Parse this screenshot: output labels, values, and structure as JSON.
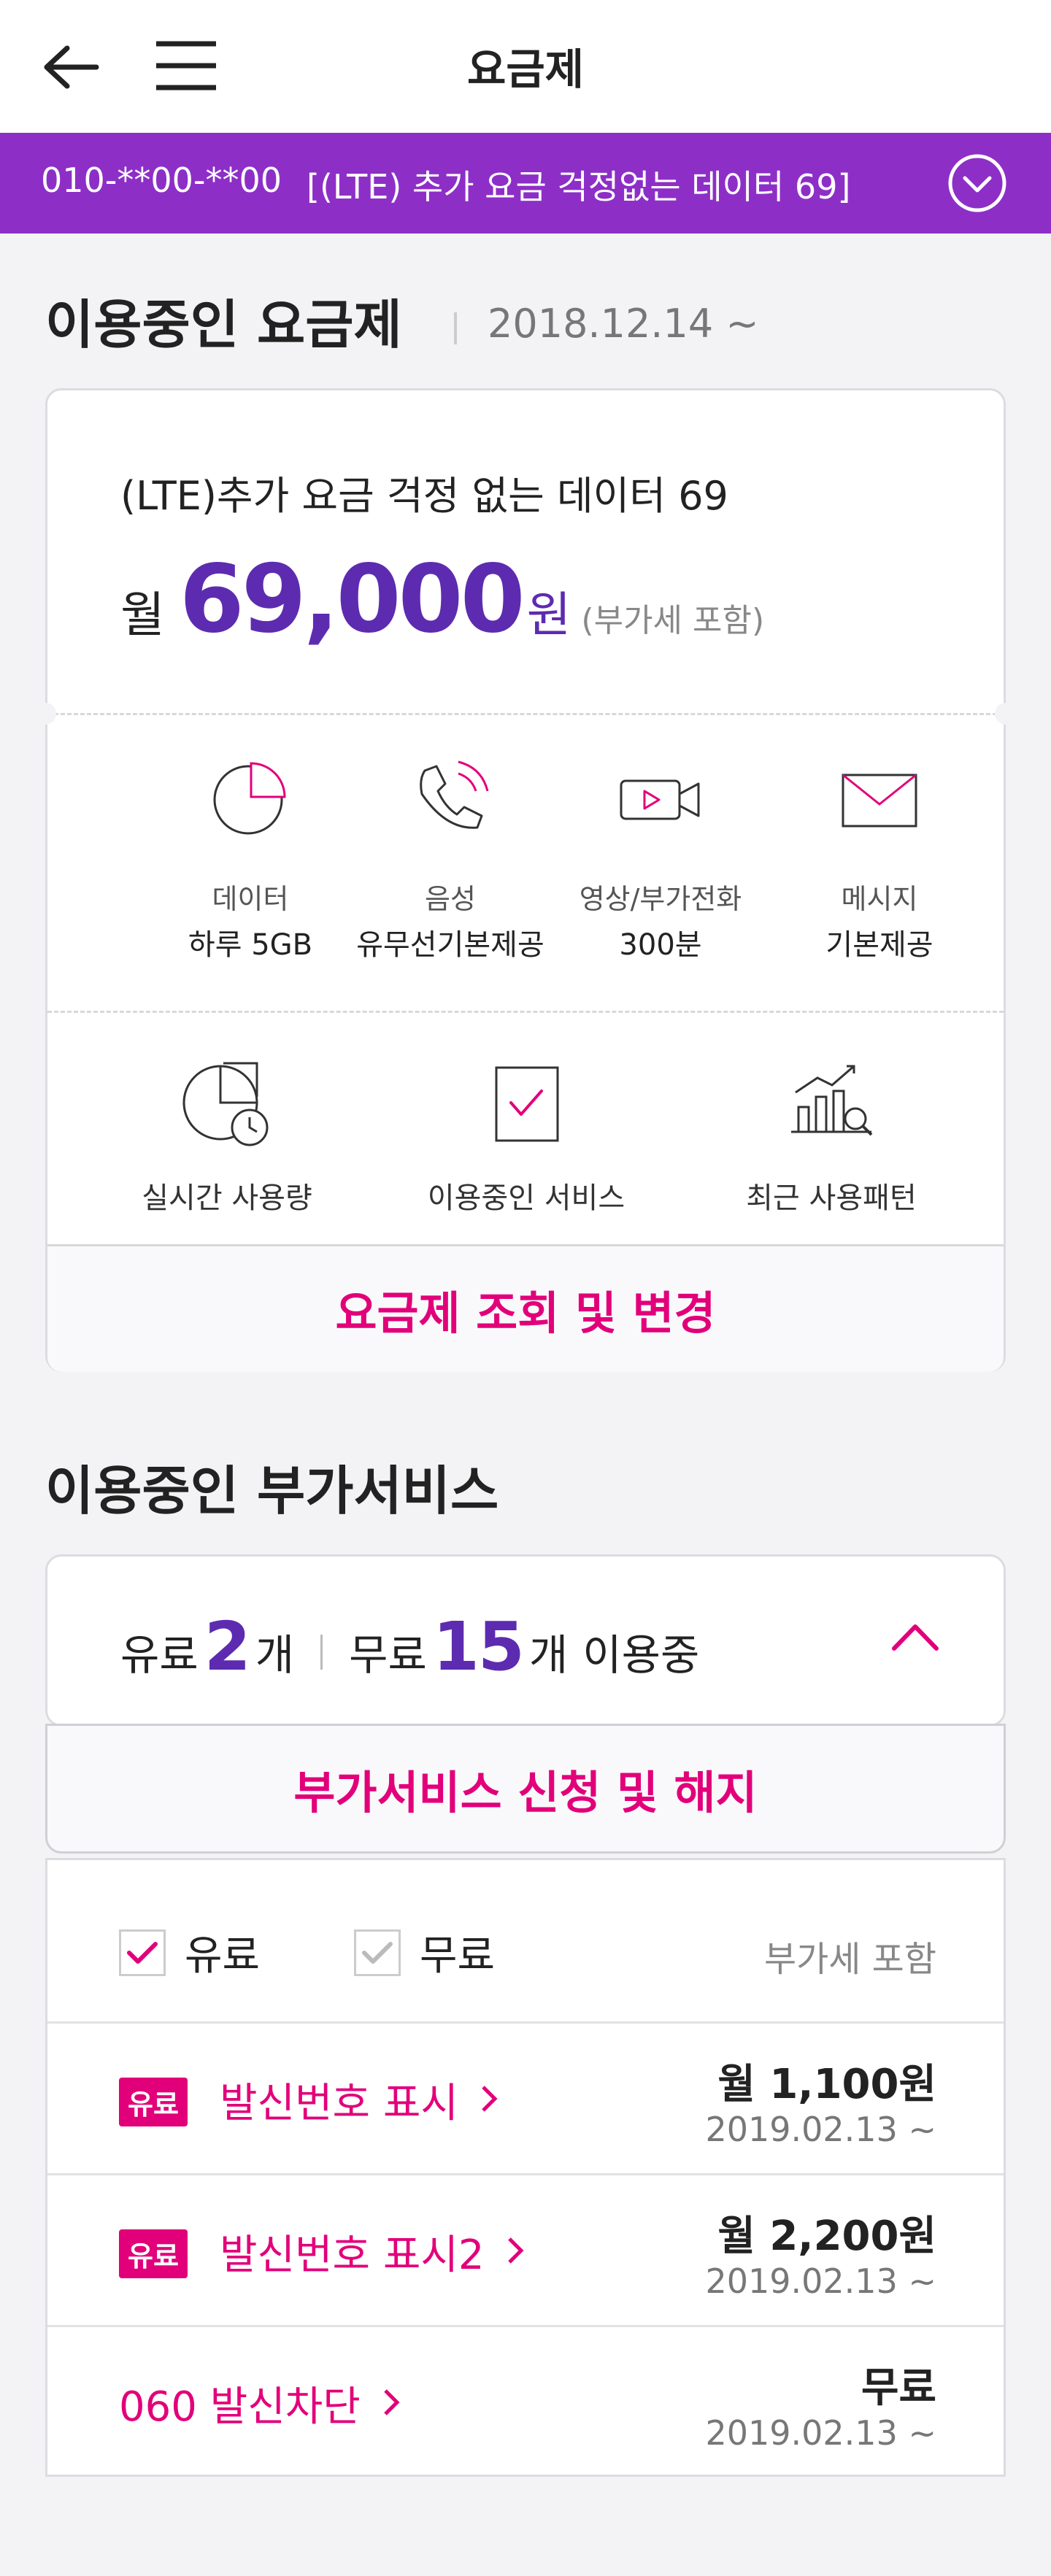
{
  "header": {
    "title": "요금제",
    "back_icon": "arrow-left-icon",
    "menu_icon": "hamburger-menu-icon"
  },
  "line_selector": {
    "phone_number": "010-**00-**00",
    "plan": "[(LTE) 추가 요금 걱정없는 데이터 69]",
    "toggle_icon": "chevron-down-circle-icon"
  },
  "current_plan": {
    "section_title": "이용중인 요금제",
    "since": "2018.12.14 ~",
    "plan_name": "(LTE)추가 요금 걱정 없는 데이터 69",
    "price_prefix": "월",
    "price_amount": "69,000",
    "price_unit": "원",
    "price_note": "(부가세 포함)",
    "features": [
      {
        "icon": "pie-chart-icon",
        "label": "데이터",
        "value": "하루 5GB"
      },
      {
        "icon": "phone-call-icon",
        "label": "음성",
        "value": "유무선기본제공"
      },
      {
        "icon": "video-call-icon",
        "label": "영상/부가전화",
        "value": "300분"
      },
      {
        "icon": "envelope-icon",
        "label": "메시지",
        "value": "기본제공"
      }
    ],
    "utilities": [
      {
        "icon": "realtime-usage-icon",
        "label": "실시간 사용량"
      },
      {
        "icon": "checked-document-icon",
        "label": "이용중인 서비스"
      },
      {
        "icon": "usage-trend-icon",
        "label": "최근 사용패턴"
      }
    ],
    "change_button": "요금제 조회 및 변경"
  },
  "addons": {
    "section_title": "이용중인 부가서비스",
    "paid_label": "유료",
    "paid_count": "2",
    "free_label": "무료",
    "free_count": "15",
    "count_unit": "개",
    "in_use": "이용중",
    "toggle_icon": "chevron-up-icon",
    "manage_button": "부가서비스 신청 및 해지",
    "filters": [
      {
        "label": "유료",
        "checked": true
      },
      {
        "label": "무료",
        "checked": true
      }
    ],
    "vat_note": "부가세 포함",
    "items": [
      {
        "badge": "유료",
        "name": "발신번호 표시",
        "price": "월 1,100원",
        "date": "2019.02.13 ~"
      },
      {
        "badge": "유료",
        "name": "발신번호 표시2",
        "price": "월 2,200원",
        "date": "2019.02.13 ~"
      },
      {
        "badge": "",
        "name": "060 발신차단",
        "price": "무료",
        "date": "2019.02.13 ~"
      }
    ]
  },
  "colors": {
    "brand_purple": "#8d2fc7",
    "price_purple": "#5d2bb0",
    "accent_magenta": "#e2007a"
  }
}
